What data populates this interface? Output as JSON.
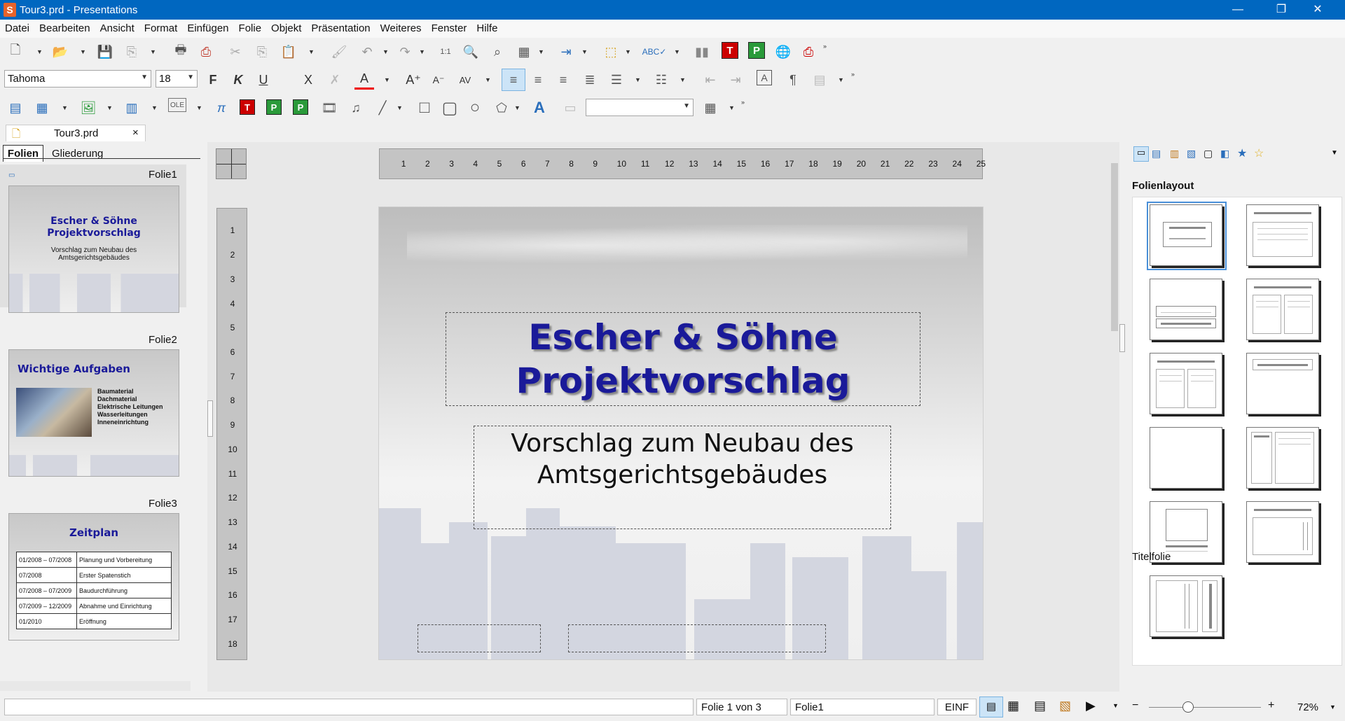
{
  "window": {
    "title": "Tour3.prd - Presentations",
    "app_icon": "S",
    "minimize": "—",
    "maximize": "❐",
    "close": "✕"
  },
  "menu": [
    "Datei",
    "Bearbeiten",
    "Ansicht",
    "Format",
    "Einfügen",
    "Folie",
    "Objekt",
    "Präsentation",
    "Weiteres",
    "Fenster",
    "Hilfe"
  ],
  "format_toolbar": {
    "font": "Tahoma",
    "size": "18",
    "bold": "F",
    "italic": "K",
    "underline": "U",
    "strike": "X"
  },
  "doc_tab": {
    "name": "Tour3.prd",
    "close": "×"
  },
  "panel_tabs": {
    "slides": "Folien",
    "outline": "Gliederung"
  },
  "slides": [
    {
      "label": "Folie1",
      "title": "Escher & Söhne Projektvorschlag",
      "subtitle": "Vorschlag zum Neubau des Amtsgerichtsgebäudes"
    },
    {
      "label": "Folie2",
      "title": "Wichtige Aufgaben",
      "bullets": [
        "Baumaterial",
        "Dachmaterial",
        "Elektrische Leitungen",
        "Wasserleitungen",
        "Inneneinrichtung"
      ]
    },
    {
      "label": "Folie3",
      "title": "Zeitplan",
      "rows": [
        [
          "01/2008 – 07/2008",
          "Planung und Vorbereitung"
        ],
        [
          "07/2008",
          "Erster Spatenstich"
        ],
        [
          "07/2008 – 07/2009",
          "Baudurchführung"
        ],
        [
          "07/2009 – 12/2009",
          "Abnahme und Einrichtung"
        ],
        [
          "01/2010",
          "Eröffnung"
        ]
      ]
    }
  ],
  "ruler_h": [
    "1",
    "2",
    "3",
    "4",
    "5",
    "6",
    "7",
    "8",
    "9",
    "10",
    "11",
    "12",
    "13",
    "14",
    "15",
    "16",
    "17",
    "18",
    "19",
    "20",
    "21",
    "22",
    "23",
    "24",
    "25"
  ],
  "ruler_v": [
    "1",
    "2",
    "3",
    "4",
    "5",
    "6",
    "7",
    "8",
    "9",
    "10",
    "11",
    "12",
    "13",
    "14",
    "15",
    "16",
    "17",
    "18"
  ],
  "main_slide": {
    "title_line1": "Escher & Söhne",
    "title_line2": "Projektvorschlag",
    "subtitle_line1": "Vorschlag zum Neubau des",
    "subtitle_line2": "Amtsgerichtsgebäudes"
  },
  "sidebar": {
    "heading": "Folienlayout",
    "selected_layout": "Titelfolie"
  },
  "status": {
    "slide_pos": "Folie 1 von 3",
    "slide_name": "Folie1",
    "mode": "EINF",
    "zoom": "72%"
  },
  "colors": {
    "titlebar": "#0067c0",
    "slide_title": "#1a1a99"
  }
}
